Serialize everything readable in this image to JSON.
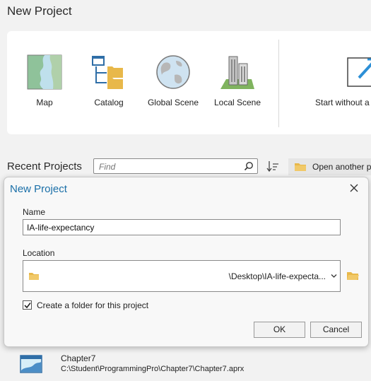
{
  "page": {
    "title": "New Project"
  },
  "templates": [
    {
      "label": "Map",
      "icon": "map-icon"
    },
    {
      "label": "Catalog",
      "icon": "catalog-icon"
    },
    {
      "label": "Global Scene",
      "icon": "globe-icon"
    },
    {
      "label": "Local Scene",
      "icon": "local-scene-icon"
    },
    {
      "label": "Start without a",
      "icon": "start-without-template-icon"
    }
  ],
  "recent": {
    "title": "Recent Projects",
    "find_placeholder": "Find",
    "open_another_label": "Open another p",
    "items": [
      {
        "name": "Chapter7",
        "path": "C:\\Student\\ProgrammingPro\\Chapter7\\Chapter7.aprx"
      }
    ]
  },
  "dialog": {
    "title": "New Project",
    "name_label": "Name",
    "name_value": "IA-life-expectancy",
    "location_label": "Location",
    "location_value": "\\Desktop\\IA-life-expecta...",
    "create_folder_label": "Create a folder for this project",
    "create_folder_checked": true,
    "ok_label": "OK",
    "cancel_label": "Cancel"
  },
  "colors": {
    "accent": "#1a6fa8",
    "folder": "#e8b84a"
  }
}
